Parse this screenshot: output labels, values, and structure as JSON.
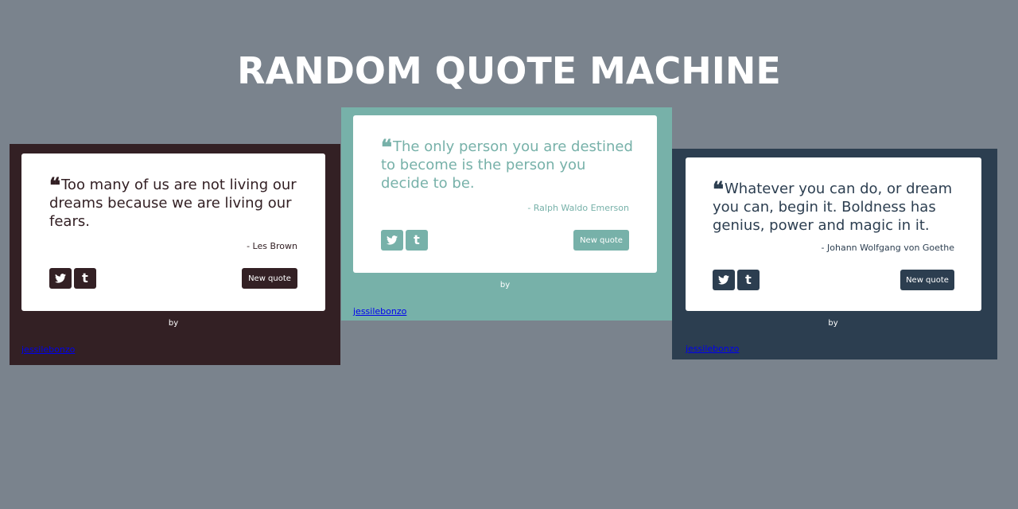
{
  "page": {
    "title": "RANDOM QUOTE MACHINE",
    "background": "#7a838d"
  },
  "cards": [
    {
      "theme": "dark-maroon",
      "accent": "#332024",
      "quote": "Too many of us are not living our dreams because we are living our fears.",
      "author": "- Les Brown",
      "twitter_icon": "twitter-icon",
      "tumblr_icon": "tumblr-icon",
      "tumblr_glyph": "t",
      "new_quote_label": "New quote",
      "by_label": "by",
      "credit_link": "jessilebonzo"
    },
    {
      "theme": "teal",
      "accent": "#77b1a9",
      "quote": "The only person you are destined to become is the person you decide to be.",
      "author": "- Ralph Waldo Emerson",
      "twitter_icon": "twitter-icon",
      "tumblr_icon": "tumblr-icon",
      "tumblr_glyph": "t",
      "new_quote_label": "New quote",
      "by_label": "by",
      "credit_link": "jessilebonzo"
    },
    {
      "theme": "navy",
      "accent": "#2c3e50",
      "quote": "Whatever you can do, or dream you can, begin it. Boldness has genius, power and magic in it.",
      "author": "- Johann Wolfgang von Goethe",
      "twitter_icon": "twitter-icon",
      "tumblr_icon": "tumblr-icon",
      "tumblr_glyph": "t",
      "new_quote_label": "New quote",
      "by_label": "by",
      "credit_link": "jessilebonzo"
    }
  ]
}
